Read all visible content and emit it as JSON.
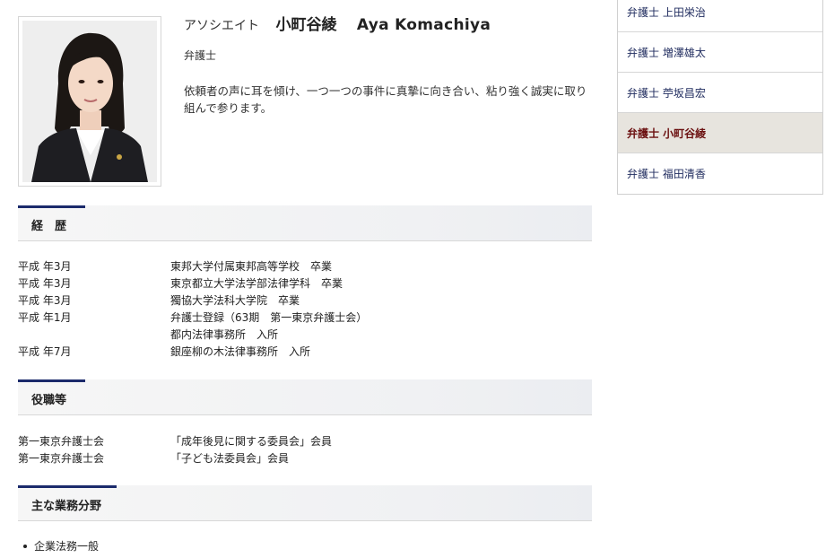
{
  "profile": {
    "rank": "アソシエイト",
    "name_jp": "小町谷綾",
    "name_en": "Aya Komachiya",
    "title": "弁護士",
    "intro": "依頼者の声に耳を傾け、一つ一つの事件に真摯に向き合い、粘り強く誠実に取り組んで参ります。"
  },
  "sections": {
    "history": "経　歴",
    "positions": "役職等",
    "practice": "主な業務分野"
  },
  "history": [
    {
      "date": "平成 年3月",
      "text": "東邦大学付属東邦高等学校　卒業"
    },
    {
      "date": "平成 年3月",
      "text": "東京都立大学法学部法律学科　卒業"
    },
    {
      "date": "平成 年3月",
      "text": "獨協大学法科大学院　卒業"
    },
    {
      "date": "平成 年1月",
      "text": "弁護士登録（63期　第一東京弁護士会）"
    },
    {
      "date": "",
      "text": "都内法律事務所　入所"
    },
    {
      "date": "平成 年7月",
      "text": "銀座柳の木法律事務所　入所"
    }
  ],
  "positions": [
    {
      "org": "第一東京弁護士会",
      "role": "「成年後見に関する委員会」会員"
    },
    {
      "org": "第一東京弁護士会",
      "role": "「子ども法委員会」会員"
    }
  ],
  "practice_areas": [
    "企業法務一般"
  ],
  "sidebar": {
    "items": [
      {
        "label": "弁護士 上田栄治",
        "active": false
      },
      {
        "label": "弁護士 増澤雄太",
        "active": false
      },
      {
        "label": "弁護士 苧坂昌宏",
        "active": false
      },
      {
        "label": "弁護士 小町谷綾",
        "active": true
      },
      {
        "label": "弁護士 福田清香",
        "active": false
      }
    ]
  },
  "colors": {
    "accent": "#1b2a6b",
    "active_bg": "#e7e4de",
    "active_text": "#6b1010",
    "link": "#1f2b5e"
  }
}
